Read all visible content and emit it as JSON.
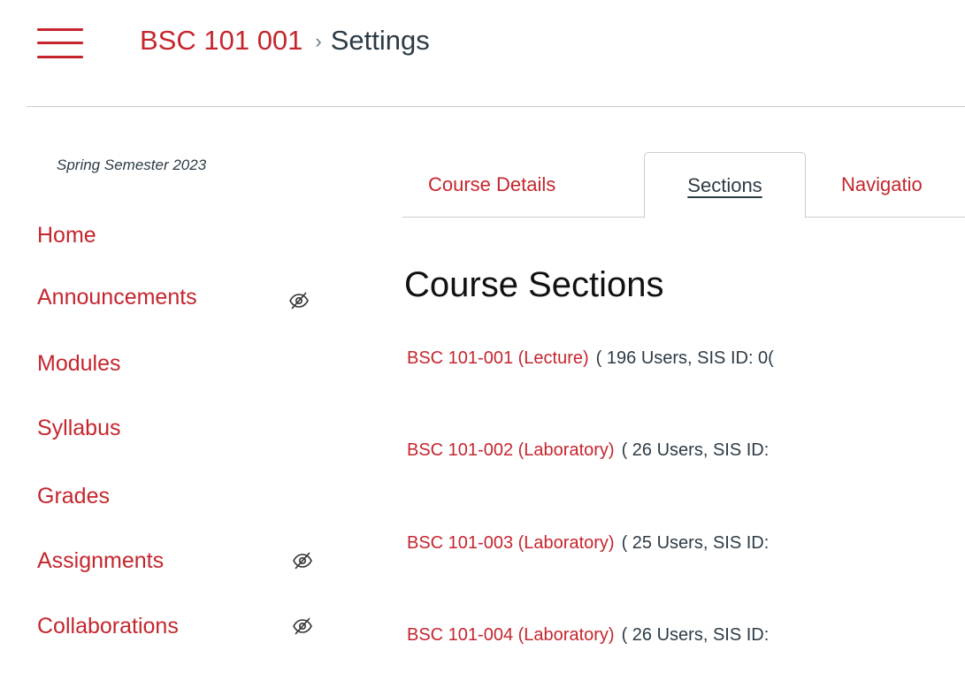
{
  "header": {
    "course_link": "BSC 101 001",
    "separator": "›",
    "current_page": "Settings"
  },
  "sidebar": {
    "term": "Spring Semester 2023",
    "items": [
      {
        "label": "Home",
        "hidden": false
      },
      {
        "label": "Announcements",
        "hidden": true
      },
      {
        "label": "Modules",
        "hidden": false
      },
      {
        "label": "Syllabus",
        "hidden": false
      },
      {
        "label": "Grades",
        "hidden": false
      },
      {
        "label": "Assignments",
        "hidden": true
      },
      {
        "label": "Collaborations",
        "hidden": true
      }
    ]
  },
  "tabs": [
    {
      "label": "Course Details",
      "active": false
    },
    {
      "label": "Sections",
      "active": true
    },
    {
      "label": "Navigatio",
      "active": false
    }
  ],
  "main": {
    "title": "Course Sections",
    "sections": [
      {
        "name": "BSC 101-001 (Lecture)",
        "meta": "( 196 Users, SIS ID: 0("
      },
      {
        "name": "BSC 101-002 (Laboratory)",
        "meta": "( 26 Users, SIS ID:"
      },
      {
        "name": "BSC 101-003 (Laboratory)",
        "meta": "( 25 Users, SIS ID:"
      },
      {
        "name": "BSC 101-004 (Laboratory)",
        "meta": "( 26 Users, SIS ID:"
      }
    ]
  },
  "colors": {
    "accent": "#c5262e",
    "text": "#2d3b45",
    "border": "#c7cdd1"
  },
  "icons": {
    "menu": "hamburger-menu-icon",
    "hidden": "eye-slash-icon"
  }
}
